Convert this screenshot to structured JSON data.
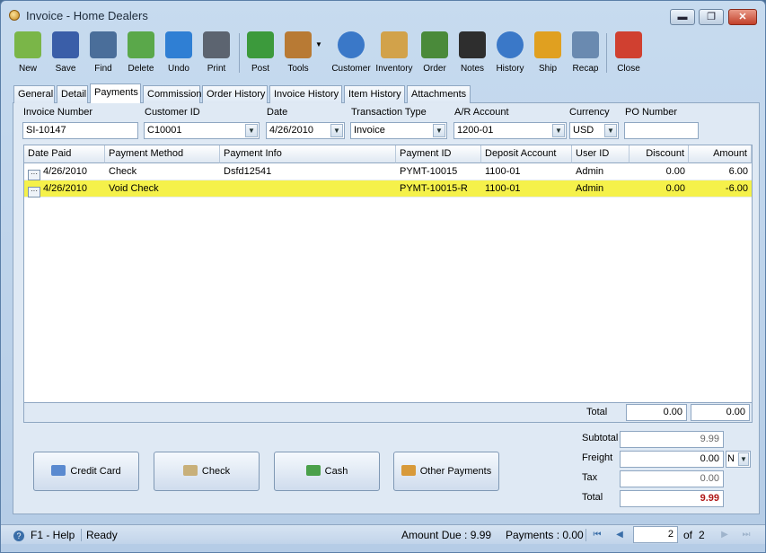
{
  "window": {
    "title": "Invoice - Home Dealers",
    "min": "▬",
    "max": "❐",
    "close": "✕"
  },
  "toolbar": [
    {
      "label": "New",
      "color": "#7ab648"
    },
    {
      "label": "Save",
      "color": "#3a5ea8"
    },
    {
      "label": "Find",
      "color": "#4a6e9a"
    },
    {
      "label": "Delete",
      "color": "#5aa84a"
    },
    {
      "label": "Undo",
      "color": "#2f7fd4"
    },
    {
      "label": "Print",
      "color": "#5c6470"
    },
    {
      "label": "Post",
      "color": "#3c9a3c"
    },
    {
      "label": "Tools",
      "color": "#b87a34"
    },
    {
      "label": "Customer",
      "color": "#3a78c8"
    },
    {
      "label": "Inventory",
      "color": "#d2a24a"
    },
    {
      "label": "Order",
      "color": "#4a8a3a"
    },
    {
      "label": "Notes",
      "color": "#2e2e2e"
    },
    {
      "label": "History",
      "color": "#3a78c8"
    },
    {
      "label": "Ship",
      "color": "#e0a020"
    },
    {
      "label": "Recap",
      "color": "#6a8ab0"
    },
    {
      "label": "Close",
      "color": "#d04030"
    }
  ],
  "tabs": [
    "General",
    "Detail",
    "Payments",
    "Commission",
    "Order History",
    "Invoice History",
    "Item History",
    "Attachments"
  ],
  "active_tab": "Payments",
  "header": {
    "invoice_number_label": "Invoice Number",
    "invoice_number": "SI-10147",
    "customer_id_label": "Customer ID",
    "customer_id": "C10001",
    "date_label": "Date",
    "date": "4/26/2010",
    "transaction_type_label": "Transaction Type",
    "transaction_type": "Invoice",
    "ar_account_label": "A/R Account",
    "ar_account": "1200-01",
    "currency_label": "Currency",
    "currency": "USD",
    "po_number_label": "PO Number",
    "po_number": ""
  },
  "grid": {
    "columns": [
      "Date Paid",
      "Payment Method",
      "Payment Info",
      "Payment ID",
      "Deposit Account",
      "User ID",
      "Discount",
      "Amount"
    ],
    "rows": [
      {
        "date_paid": "4/26/2010",
        "method": "Check",
        "info": "Dsfd12541",
        "payment_id": "PYMT-10015",
        "deposit_account": "1100-01",
        "user_id": "Admin",
        "discount": "0.00",
        "amount": "6.00"
      },
      {
        "date_paid": "4/26/2010",
        "method": "Void Check",
        "info": "",
        "payment_id": "PYMT-10015-R",
        "deposit_account": "1100-01",
        "user_id": "Admin",
        "discount": "0.00",
        "amount": "-6.00"
      }
    ],
    "total_label": "Total",
    "total_discount": "0.00",
    "total_amount": "0.00",
    "ellipsis": "···"
  },
  "payment_buttons": [
    "Credit Card",
    "Check",
    "Cash",
    "Other Payments"
  ],
  "summary": {
    "subtotal_label": "Subtotal",
    "subtotal": "9.99",
    "freight_label": "Freight",
    "freight": "0.00",
    "freight_code": "N",
    "tax_label": "Tax",
    "tax": "0.00",
    "total_label": "Total",
    "total": "9.99"
  },
  "status": {
    "help": "F1 - Help",
    "ready": "Ready",
    "amount_due": "Amount Due : 9.99",
    "payments": "Payments : 0.00",
    "page": "2",
    "of_label": "of",
    "page_count": "2"
  }
}
